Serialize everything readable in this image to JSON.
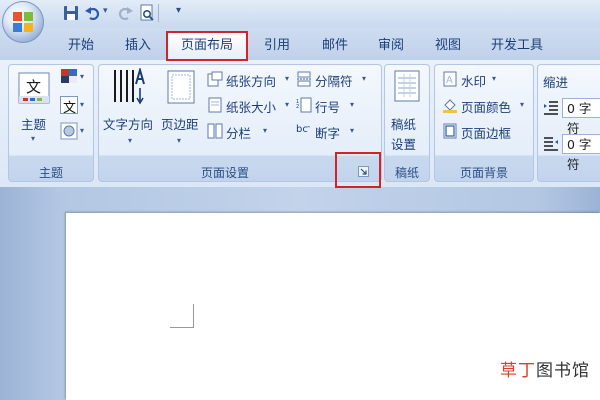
{
  "tabs": {
    "home": "开始",
    "insert": "插入",
    "page_layout": "页面布局",
    "references": "引用",
    "mailings": "邮件",
    "review": "审阅",
    "view": "视图",
    "developer": "开发工具"
  },
  "groups": {
    "themes": {
      "label": "主题",
      "theme_button": "主题",
      "theme_fonts_glyph": "文"
    },
    "page_setup": {
      "label": "页面设置",
      "text_direction": "文字方向",
      "margins": "页边距",
      "orientation": "纸张方向",
      "size": "纸张大小",
      "columns": "分栏",
      "breaks": "分隔符",
      "line_numbers": "行号",
      "hyphenation": "断字",
      "hyphen_glyph": "bc"
    },
    "manuscript": {
      "label": "稿纸",
      "button_line1": "稿纸",
      "button_line2": "设置"
    },
    "page_background": {
      "label": "页面背景",
      "watermark": "水印",
      "page_color": "页面颜色",
      "page_borders": "页面边框"
    },
    "paragraph": {
      "indent_label": "缩进",
      "left_indent_value": "0 字符",
      "right_indent_value": "0 字符"
    }
  },
  "theme_glyph": "文",
  "watermark_text": {
    "part1": "草丁",
    "part2": "图书馆"
  },
  "colors": {
    "highlight": "#d2232a",
    "ribbon": "#dce7f6",
    "text": "#15428b"
  }
}
